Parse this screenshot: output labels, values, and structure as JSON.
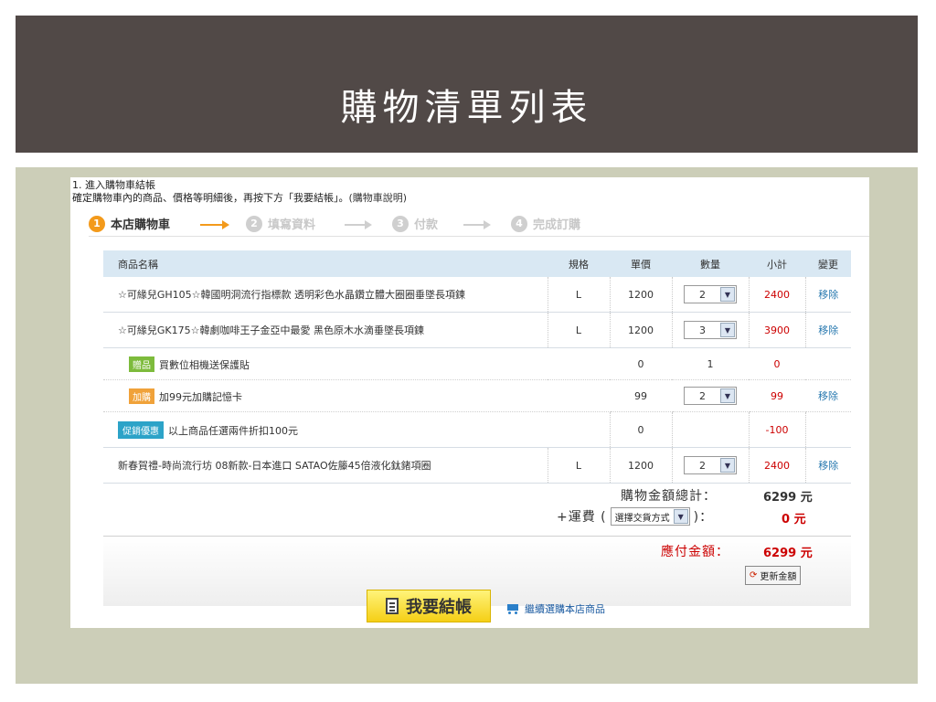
{
  "slide_title": "購物清單列表",
  "notice": {
    "line1": "1. 進入購物車結帳",
    "line2_prefix": "確定購物車內的商品、價格等明細後，再按下方「我要結帳」。",
    "help_link": "(購物車說明)"
  },
  "steps": [
    {
      "num": "1",
      "label": "本店購物車",
      "active": true
    },
    {
      "num": "2",
      "label": "填寫資料",
      "active": false
    },
    {
      "num": "3",
      "label": "付款",
      "active": false
    },
    {
      "num": "4",
      "label": "完成訂購",
      "active": false
    }
  ],
  "table": {
    "headers": {
      "name": "商品名稱",
      "spec": "規格",
      "price": "單價",
      "qty": "數量",
      "subtotal": "小計",
      "action": "變更"
    },
    "rows": [
      {
        "name": "☆可緣兒GH105☆韓國明洞流行指標款 透明彩色水晶鑽立體大圈圈垂墜長項鍊",
        "spec": "L",
        "price": "1200",
        "qty": "2",
        "subtotal": "2400",
        "action": "移除"
      },
      {
        "name": "☆可緣兒GK175☆韓劇咖啡王子金亞中最愛 黑色原木水滴垂墜長項鍊",
        "spec": "L",
        "price": "1200",
        "qty": "3",
        "subtotal": "3900",
        "action": "移除"
      },
      {
        "tag": "贈品",
        "name": "買數位相機送保護貼",
        "spec": "",
        "price": "0",
        "qty": "1",
        "subtotal": "0",
        "action": ""
      },
      {
        "tag": "加購",
        "name": "加99元加購記憶卡",
        "spec": "",
        "price": "99",
        "qty": "2",
        "subtotal": "99",
        "action": "移除"
      },
      {
        "tag": "促銷優惠",
        "name": "以上商品任選兩件折扣100元",
        "spec": "",
        "price": "0",
        "qty": "",
        "subtotal": "-100",
        "action": ""
      },
      {
        "name": "新春賀禮-時尚流行坊 08新款-日本進口 SATAO佐籐45倍液化鈦鍺項圈",
        "spec": "L",
        "price": "1200",
        "qty": "2",
        "subtotal": "2400",
        "action": "移除"
      }
    ]
  },
  "totals": {
    "goods_label": "購物金額總計：",
    "goods_value": "6299 元",
    "ship_prefix": "+運費 (",
    "ship_select": "選擇交貨方式",
    "ship_suffix": ")：",
    "ship_value": "0 元",
    "pay_label": "應付金額：",
    "pay_value": "6299 元",
    "refresh_label": "更新金額"
  },
  "checkout_label": "我要結帳",
  "continue_label": "繼續選購本店商品",
  "colors": {
    "title_bg": "#514947",
    "stage_bg": "#ccceb8",
    "accent_orange": "#f39a1b",
    "price_red": "#cc0000"
  }
}
